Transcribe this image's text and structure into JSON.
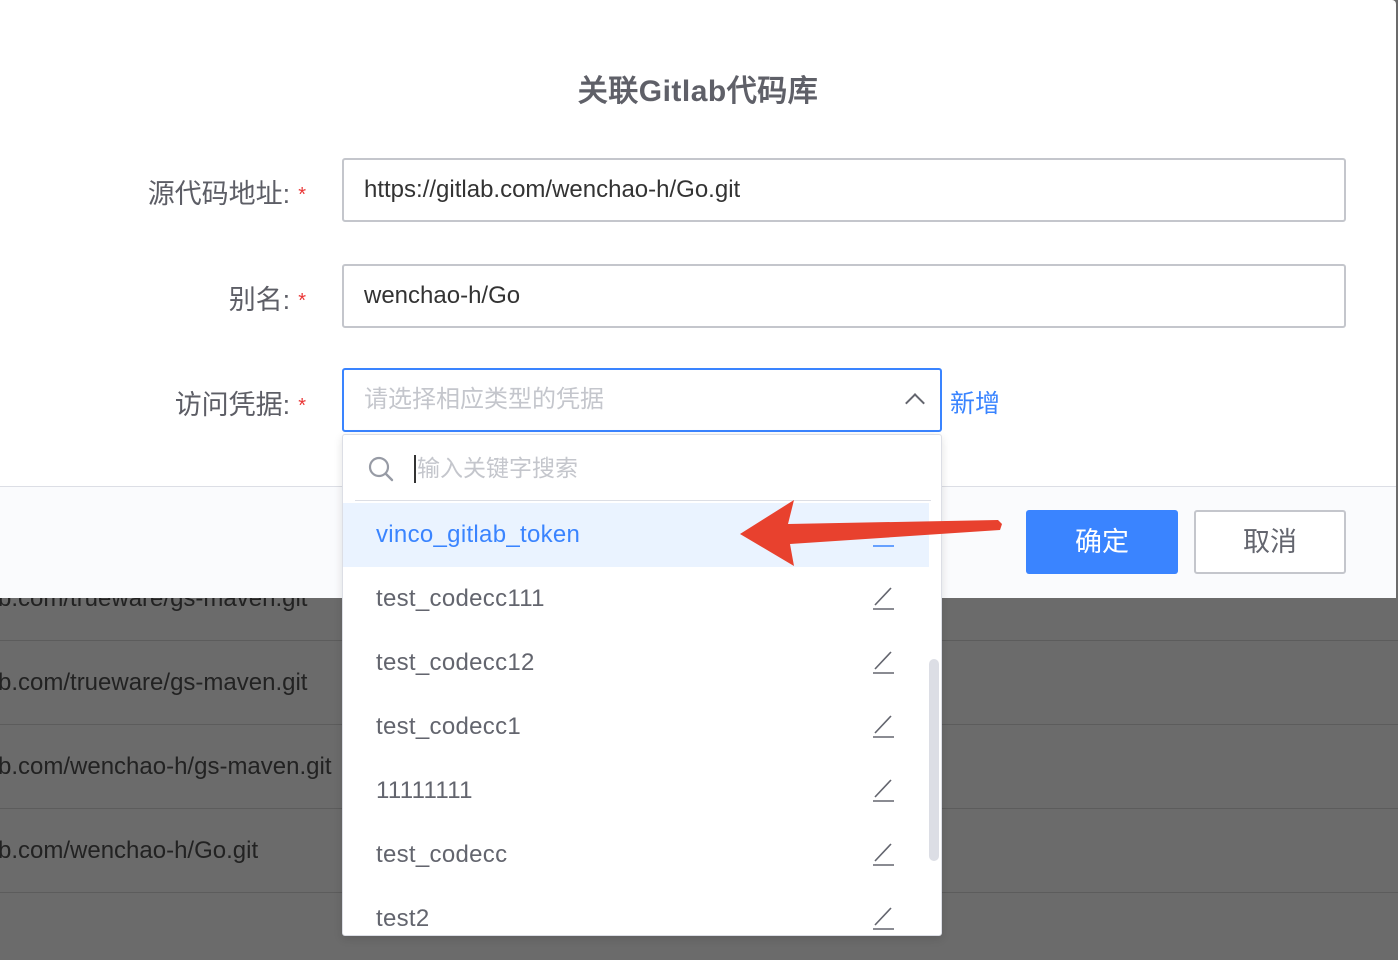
{
  "background_rows": [
    {
      "text": "b.com/trueware/gs-maven.git"
    },
    {
      "text": "b.com/trueware/gs-maven.git"
    },
    {
      "text": "b.com/wenchao-h/gs-maven.git"
    },
    {
      "text": "b.com/wenchao-h/Go.git"
    }
  ],
  "dialog": {
    "title": "关联Gitlab代码库",
    "fields": {
      "source_url": {
        "label": "源代码地址:",
        "required": "*",
        "value": "https://gitlab.com/wenchao-h/Go.git"
      },
      "alias": {
        "label": "别名:",
        "required": "*",
        "value": "wenchao-h/Go"
      },
      "credential": {
        "label": "访问凭据:",
        "required": "*",
        "placeholder": "请选择相应类型的凭据",
        "add_link": "新增"
      }
    },
    "footer": {
      "confirm": "确定",
      "cancel": "取消"
    }
  },
  "dropdown": {
    "search_placeholder": "输入关键字搜索",
    "options": [
      {
        "label": "vinco_gitlab_token",
        "active": true
      },
      {
        "label": "test_codecc111",
        "active": false
      },
      {
        "label": "test_codecc12",
        "active": false
      },
      {
        "label": "test_codecc1",
        "active": false
      },
      {
        "label": "11111111",
        "active": false
      },
      {
        "label": "test_codecc",
        "active": false
      },
      {
        "label": "test2",
        "active": false
      }
    ]
  },
  "colors": {
    "primary": "#3a84ff",
    "required": "#ea3636",
    "annotation_arrow": "#e8412e"
  },
  "icons": {
    "search": "search-icon",
    "edit": "edit-icon",
    "chevron": "chevron-up-icon"
  }
}
